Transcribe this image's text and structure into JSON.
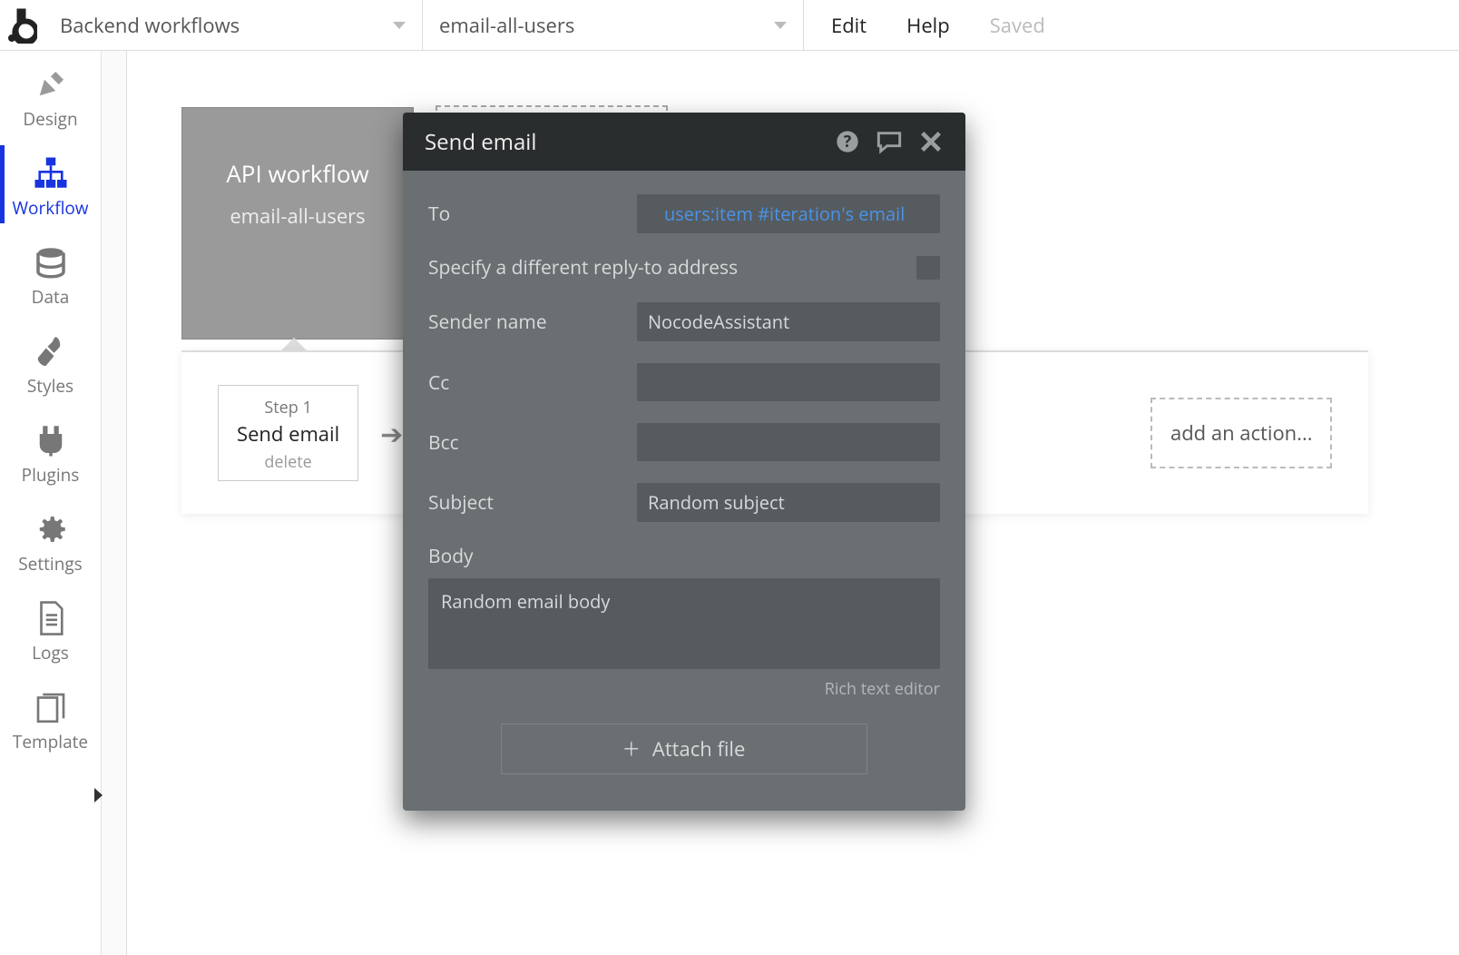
{
  "topbar": {
    "page_selector": "Backend workflows",
    "workflow_selector": "email-all-users",
    "edit": "Edit",
    "help": "Help",
    "saved": "Saved"
  },
  "sidebar": {
    "items": [
      {
        "label": "Design"
      },
      {
        "label": "Workflow"
      },
      {
        "label": "Data"
      },
      {
        "label": "Styles"
      },
      {
        "label": "Plugins"
      },
      {
        "label": "Settings"
      },
      {
        "label": "Logs"
      },
      {
        "label": "Template"
      }
    ]
  },
  "workflow_card": {
    "title": "API workflow",
    "name": "email-all-users"
  },
  "step": {
    "number": "Step 1",
    "name": "Send email",
    "delete": "delete"
  },
  "add_action": "add an action...",
  "panel": {
    "title": "Send email",
    "fields": {
      "to_label": "To",
      "to_value": "users:item #iteration's email",
      "replyto_label": "Specify a different reply-to address",
      "sender_label": "Sender name",
      "sender_value": "NocodeAssistant",
      "cc_label": "Cc",
      "cc_value": "",
      "bcc_label": "Bcc",
      "bcc_value": "",
      "subject_label": "Subject",
      "subject_value": "Random subject",
      "body_label": "Body",
      "body_value": "Random email body",
      "rte": "Rich text editor",
      "attach": "Attach file"
    }
  }
}
